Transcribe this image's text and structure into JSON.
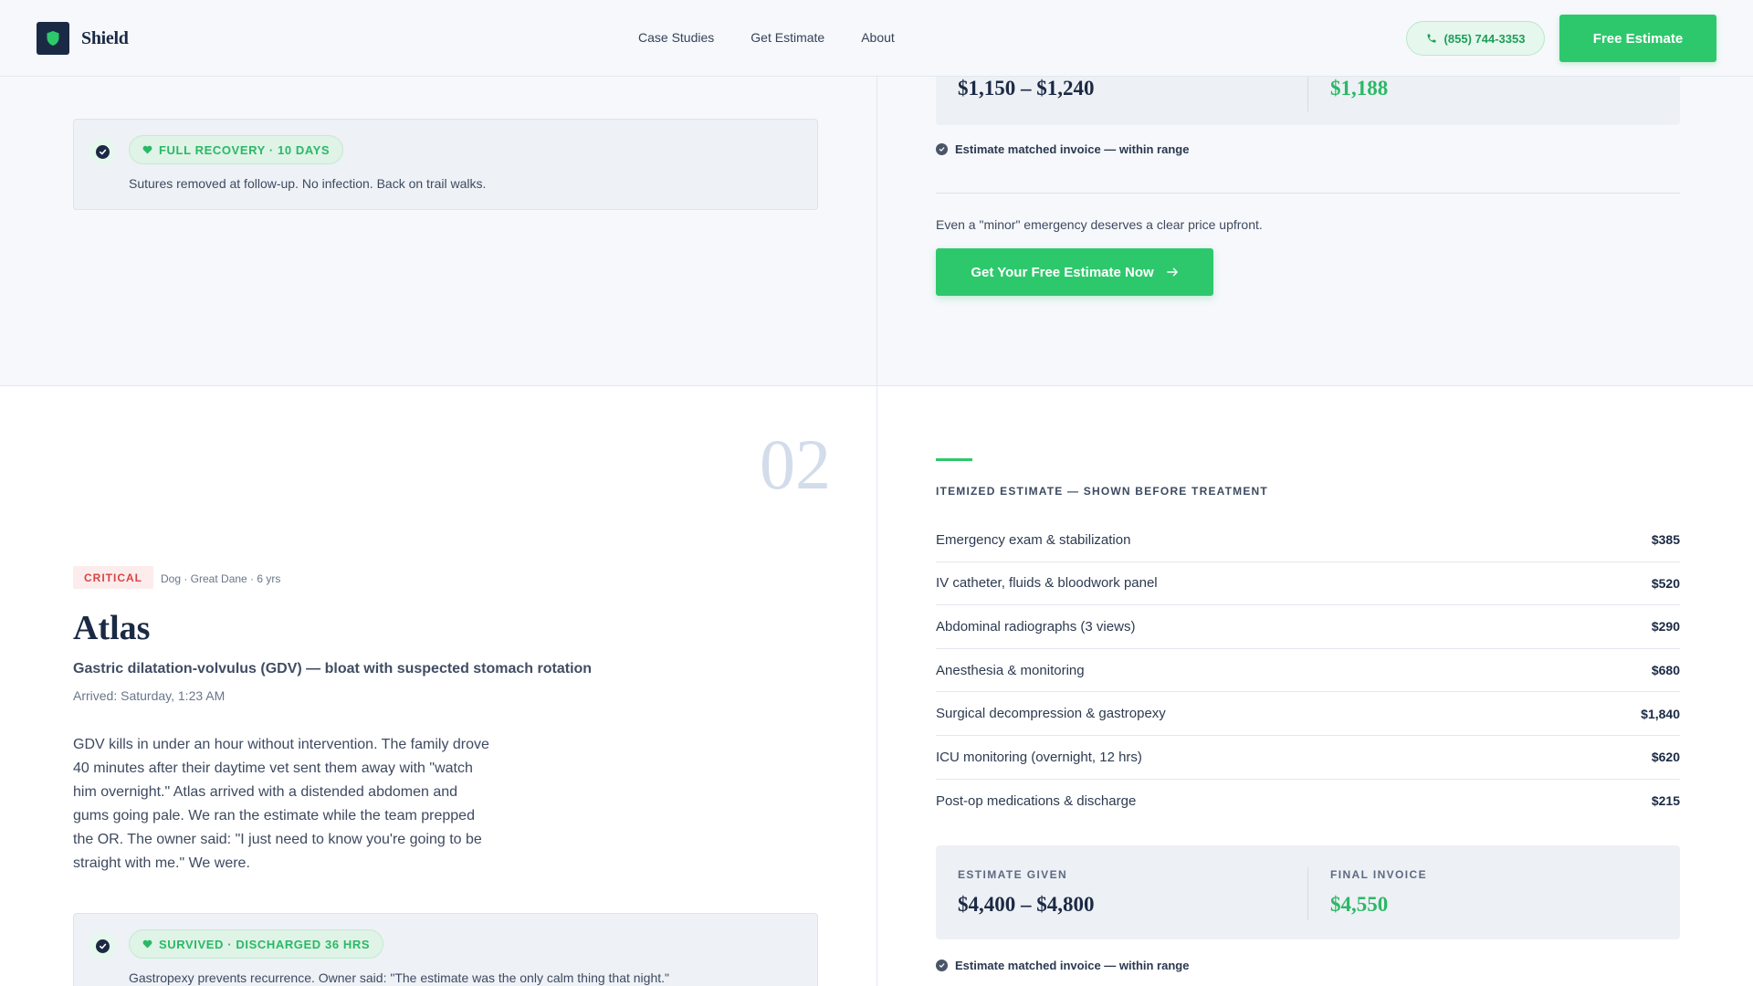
{
  "header": {
    "brand": "Shield",
    "nav": [
      "Case Studies",
      "Get Estimate",
      "About"
    ],
    "phone": "(855) 744-3353",
    "cta": "Free Estimate"
  },
  "case1": {
    "estimate_given": "$1,150 – $1,240",
    "final_invoice": "$1,188",
    "outcome_badge": "FULL RECOVERY · 10 DAYS",
    "outcome_text": "Sutures removed at follow-up. No infection. Back on trail walks.",
    "match_text": "Estimate matched invoice — within range",
    "pitch": "Even a \"minor\" emergency deserves a clear price upfront.",
    "cta": "Get Your Free Estimate Now"
  },
  "case2": {
    "number": "02",
    "severity": "CRITICAL",
    "meta": "Dog · Great Dane · 6 yrs",
    "name": "Atlas",
    "diagnosis": "Gastric dilatation-volvulus (GDV) — bloat with suspected stomach rotation",
    "arrived": "Arrived: Saturday, 1:23 AM",
    "story": "GDV kills in under an hour without intervention. The family drove 40 minutes after their daytime vet sent them away with \"watch him overnight.\" Atlas arrived with a distended abdomen and gums going pale. We ran the estimate while the team prepped the OR. The owner said: \"I just need to know you're going to be straight with me.\" We were.",
    "outcome_badge": "SURVIVED · DISCHARGED 36 HRS",
    "outcome_text": "Gastropexy prevents recurrence. Owner said: \"The estimate was the only calm thing that night.\"",
    "estimate_heading": "ITEMIZED ESTIMATE — SHOWN BEFORE TREATMENT",
    "line_items": [
      {
        "label": "Emergency exam & stabilization",
        "amount": "$385"
      },
      {
        "label": "IV catheter, fluids & bloodwork panel",
        "amount": "$520"
      },
      {
        "label": "Abdominal radiographs (3 views)",
        "amount": "$290"
      },
      {
        "label": "Anesthesia & monitoring",
        "amount": "$680"
      },
      {
        "label": "Surgical decompression & gastropexy",
        "amount": "$1,840"
      },
      {
        "label": "ICU monitoring (overnight, 12 hrs)",
        "amount": "$620"
      },
      {
        "label": "Post-op medications & discharge",
        "amount": "$215"
      }
    ],
    "estimate_given_label": "ESTIMATE GIVEN",
    "estimate_given": "$4,400 – $4,800",
    "final_invoice_label": "FINAL INVOICE",
    "final_invoice": "$4,550",
    "match_text": "Estimate matched invoice — within range"
  },
  "colors": {
    "navy": "#1b2a44",
    "green": "#2ec86c",
    "critical": "#d64545"
  },
  "icons": [
    "shield-icon",
    "phone-icon",
    "check-circle-icon",
    "heart-icon",
    "arrow-right-icon"
  ]
}
